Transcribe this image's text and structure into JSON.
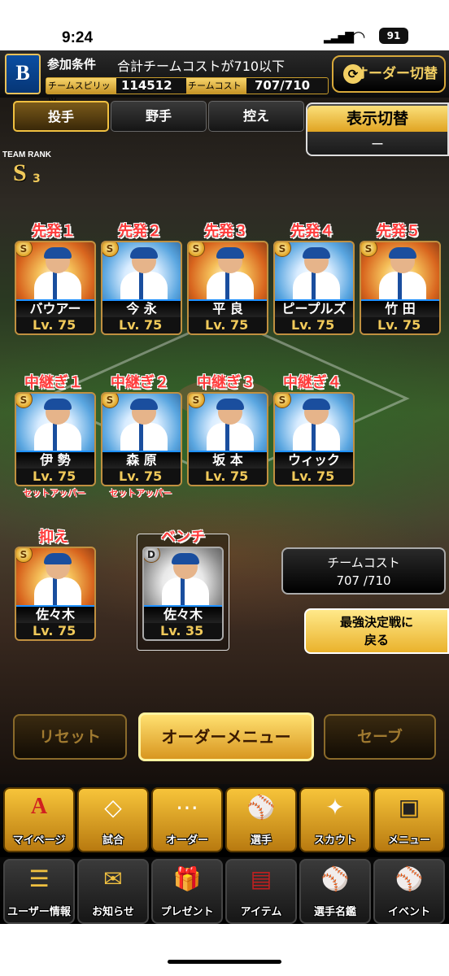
{
  "status": {
    "time": "9:24",
    "battery": "91"
  },
  "header": {
    "logo": "B",
    "cond_label": "参加条件",
    "cond_value": "合計チームコストが710以下",
    "spirit_label": "チームスピリッツ",
    "spirit_value": "114512",
    "cost_label": "チームコスト",
    "cost_value": "707/710",
    "order_switch": "オーダー切替"
  },
  "tabs": [
    {
      "label": "投手"
    },
    {
      "label": "野手"
    },
    {
      "label": "控え"
    }
  ],
  "display_toggle": {
    "label": "表示切替",
    "value": "ー"
  },
  "team_rank": {
    "label": "TEAM RANK",
    "value": "S",
    "sub": "3"
  },
  "starters": [
    {
      "slot": "先発１",
      "name": "バウアー",
      "level": "Lv. 75",
      "rank": "S"
    },
    {
      "slot": "先発２",
      "name": "今 永",
      "level": "Lv. 75",
      "rank": "S"
    },
    {
      "slot": "先発３",
      "name": "平 良",
      "level": "Lv. 75",
      "rank": "S"
    },
    {
      "slot": "先発４",
      "name": "ピープルズ",
      "level": "Lv. 75",
      "rank": "S"
    },
    {
      "slot": "先発５",
      "name": "竹 田",
      "level": "Lv. 75",
      "rank": "S"
    }
  ],
  "relievers": [
    {
      "slot": "中継ぎ１",
      "name": "伊 勢",
      "level": "Lv. 75",
      "rank": "S",
      "role": "セットアッパー"
    },
    {
      "slot": "中継ぎ２",
      "name": "森 原",
      "level": "Lv. 75",
      "rank": "S",
      "role": "セットアッパー"
    },
    {
      "slot": "中継ぎ３",
      "name": "坂 本",
      "level": "Lv. 75",
      "rank": "S",
      "role": ""
    },
    {
      "slot": "中継ぎ４",
      "name": "ウィック",
      "level": "Lv. 75",
      "rank": "S",
      "role": ""
    }
  ],
  "closer": {
    "slot": "抑え",
    "name": "佐々木",
    "level": "Lv. 75",
    "rank": "S"
  },
  "bench": {
    "slot": "ベンチ",
    "name": "佐々木",
    "level": "Lv. 35",
    "rank": "D"
  },
  "team_cost": {
    "label": "チームコスト",
    "value": "707 /710"
  },
  "return_button": {
    "line1": "最強決定戦に",
    "line2": "戻る"
  },
  "bottom_buttons": {
    "reset": "リセット",
    "order_menu": "オーダーメニュー",
    "save": "セーブ"
  },
  "menu_row1": [
    {
      "label": "マイページ",
      "icon": "A"
    },
    {
      "label": "試合",
      "icon": "◇"
    },
    {
      "label": "オーダー",
      "icon": "⋯"
    },
    {
      "label": "選手",
      "icon": "⚾"
    },
    {
      "label": "スカウト",
      "icon": "✦"
    },
    {
      "label": "メニュー",
      "icon": "▣"
    }
  ],
  "menu_row2": [
    {
      "label": "ユーザー情報",
      "icon": "☰"
    },
    {
      "label": "お知らせ",
      "icon": "✉"
    },
    {
      "label": "プレゼント",
      "icon": "🎁"
    },
    {
      "label": "アイテム",
      "icon": "▤"
    },
    {
      "label": "選手名鑑",
      "icon": "⚾"
    },
    {
      "label": "イベント",
      "icon": "⚾"
    }
  ]
}
